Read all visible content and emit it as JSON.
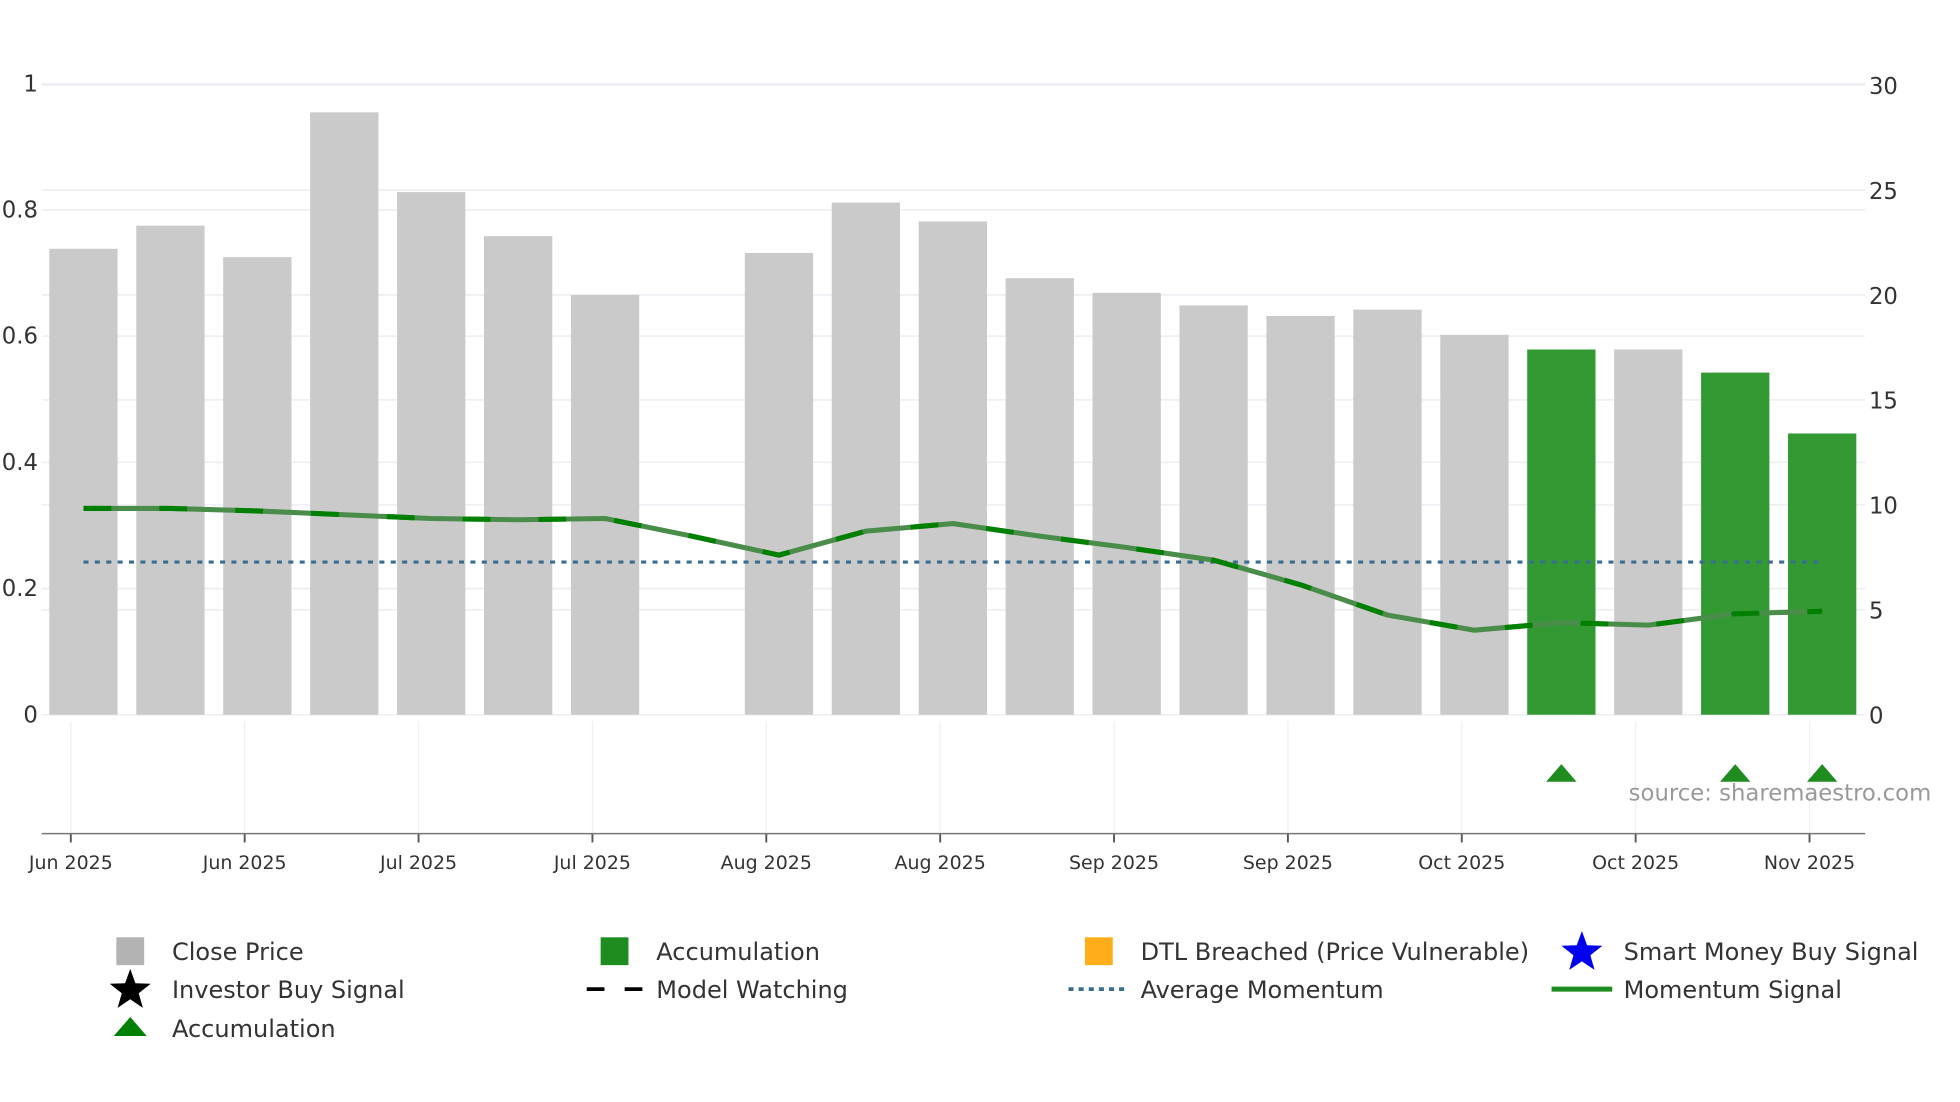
{
  "chart_data": {
    "type": "bar",
    "title": "",
    "xlabel": "",
    "ylabel_left": "",
    "ylabel_right": "",
    "left_axis": {
      "range": [
        0,
        1
      ],
      "ticks": [
        "0",
        "0.2",
        "0.4",
        "0.6",
        "0.8",
        "1"
      ]
    },
    "right_axis": {
      "range": [
        0,
        30
      ],
      "ticks": [
        "0",
        "5",
        "10",
        "15",
        "20",
        "25",
        "30"
      ]
    },
    "x_tick_labels": [
      "Jun 2025",
      "Jun 2025",
      "Jul 2025",
      "Jul 2025",
      "Aug 2025",
      "Aug 2025",
      "Sep 2025",
      "Sep 2025",
      "Oct 2025",
      "Oct 2025",
      "Nov 2025"
    ],
    "close_price": [
      22.2,
      23.3,
      21.8,
      28.7,
      24.9,
      22.8,
      20.0,
      null,
      22.0,
      24.4,
      23.5,
      20.8,
      20.1,
      19.5,
      19.0,
      19.3,
      18.1,
      17.4,
      17.4,
      16.3,
      13.4
    ],
    "bar_state": [
      "close",
      "close",
      "close",
      "close",
      "close",
      "close",
      "close",
      null,
      "close",
      "close",
      "close",
      "close",
      "close",
      "close",
      "close",
      "close",
      "close",
      "accumulation",
      "close",
      "accumulation",
      "accumulation"
    ],
    "momentum_signal": [
      0.327,
      0.327,
      0.323,
      0.317,
      0.311,
      0.309,
      0.311,
      0.283,
      0.253,
      0.291,
      0.303,
      0.283,
      0.265,
      0.245,
      0.206,
      0.158,
      0.134,
      0.146,
      0.142,
      0.16,
      0.164
    ],
    "average_momentum": 0.242,
    "accumulation_markers": [
      17,
      19,
      20
    ],
    "grid": true,
    "legend_placement": "bottom",
    "colors": {
      "close": "#cacaca",
      "accumulation": "#339933",
      "momentum": "#4a8c4a",
      "momentum_dash": "#008000",
      "average": "#3a6e8f",
      "triangle": "#1f8c1f"
    },
    "source": "source: sharemaestro.com"
  },
  "legend": [
    {
      "label": "Close Price",
      "icon": "square",
      "color": "#b3b3b3"
    },
    {
      "label": "Accumulation",
      "icon": "square",
      "color": "#1f8c1f"
    },
    {
      "label": "DTL Breached (Price Vulnerable)",
      "icon": "square",
      "color": "#ffae1a"
    },
    {
      "label": "Smart Money Buy Signal",
      "icon": "star",
      "color": "#0000ee"
    },
    {
      "label": "Investor Buy Signal",
      "icon": "star",
      "color": "#000000"
    },
    {
      "label": "Model Watching",
      "icon": "dash",
      "color": "#000000"
    },
    {
      "label": "Average Momentum",
      "icon": "dot",
      "color": "#3a6e8f"
    },
    {
      "label": "Momentum Signal",
      "icon": "line",
      "color": "#1f8c1f"
    },
    {
      "label": "Accumulation",
      "icon": "triangle",
      "color": "#008000"
    }
  ]
}
